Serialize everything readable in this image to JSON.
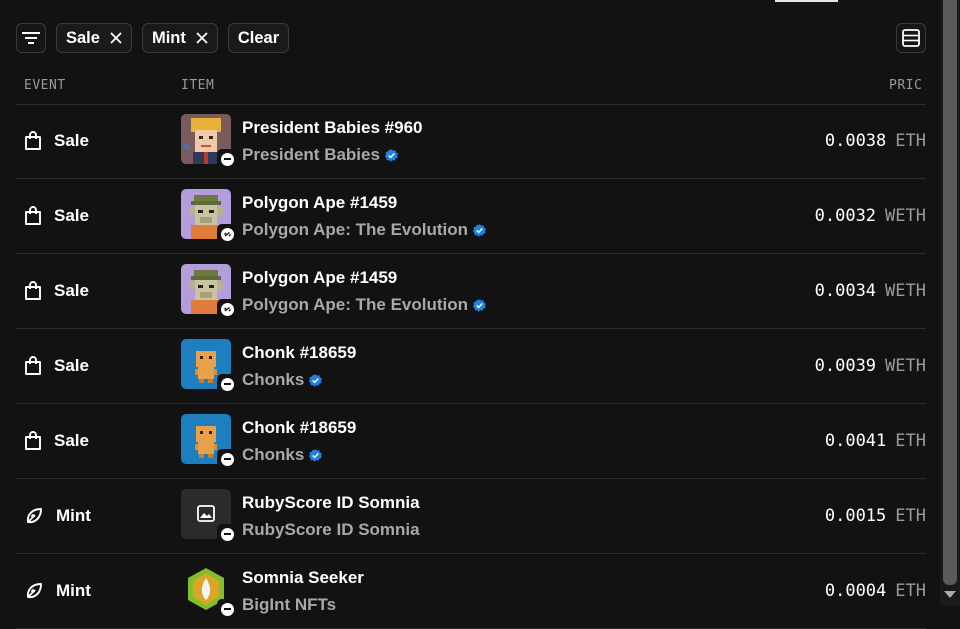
{
  "filters": {
    "chips": [
      {
        "label": "Sale"
      },
      {
        "label": "Mint"
      }
    ],
    "clear_label": "Clear"
  },
  "columns": {
    "event": "EVENT",
    "item": "ITEM",
    "price": "PRIC"
  },
  "rows": [
    {
      "event": "Sale",
      "event_icon": "shopping-bag-icon",
      "name": "President Babies #960",
      "collection": "President Babies",
      "verified": true,
      "price": "0.0038",
      "currency": "ETH",
      "thumb": "president-baby",
      "chain_icon": "chain-dash-icon"
    },
    {
      "event": "Sale",
      "event_icon": "shopping-bag-icon",
      "name": "Polygon Ape #1459",
      "collection": "Polygon Ape: The Evolution",
      "verified": true,
      "price": "0.0032",
      "currency": "WETH",
      "thumb": "ape",
      "chain_icon": "link-icon"
    },
    {
      "event": "Sale",
      "event_icon": "shopping-bag-icon",
      "name": "Polygon Ape #1459",
      "collection": "Polygon Ape: The Evolution",
      "verified": true,
      "price": "0.0034",
      "currency": "WETH",
      "thumb": "ape",
      "chain_icon": "link-icon"
    },
    {
      "event": "Sale",
      "event_icon": "shopping-bag-icon",
      "name": "Chonk #18659",
      "collection": "Chonks",
      "verified": true,
      "price": "0.0039",
      "currency": "WETH",
      "thumb": "chonk",
      "chain_icon": "chain-dash-icon"
    },
    {
      "event": "Sale",
      "event_icon": "shopping-bag-icon",
      "name": "Chonk #18659",
      "collection": "Chonks",
      "verified": true,
      "price": "0.0041",
      "currency": "ETH",
      "thumb": "chonk",
      "chain_icon": "chain-dash-icon"
    },
    {
      "event": "Mint",
      "event_icon": "mint-leaf-icon",
      "name": "RubyScore ID Somnia",
      "collection": "RubyScore ID Somnia",
      "verified": false,
      "price": "0.0015",
      "currency": "ETH",
      "thumb": "placeholder",
      "chain_icon": "chain-dash-icon"
    },
    {
      "event": "Mint",
      "event_icon": "mint-leaf-icon",
      "name": "Somnia Seeker",
      "collection": "BigInt NFTs",
      "verified": false,
      "price": "0.0004",
      "currency": "ETH",
      "thumb": "seeker",
      "chain_icon": "chain-dash-icon"
    }
  ],
  "colors": {
    "background": "#121212",
    "verified": "#2081e2",
    "muted": "#a8a8a8"
  }
}
